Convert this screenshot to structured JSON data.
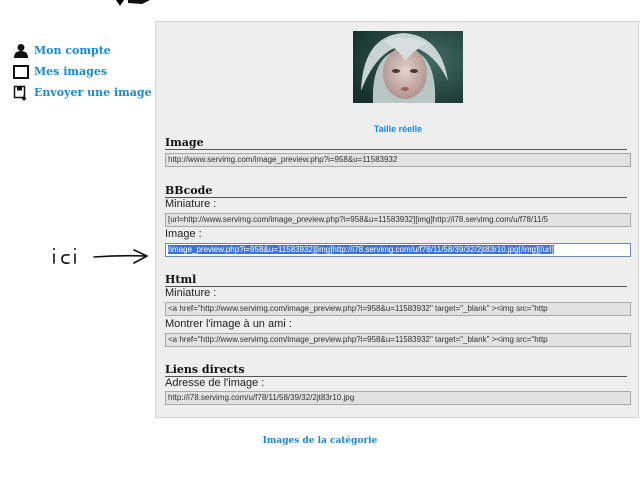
{
  "sidebar": {
    "items": [
      {
        "label": "Mon compte",
        "icon": "user-icon"
      },
      {
        "label": "Mes images",
        "icon": "image-frame-icon"
      },
      {
        "label": "Envoyer une image",
        "icon": "upload-icon"
      }
    ]
  },
  "panel": {
    "full_size_link": "Taille réelle",
    "sections": {
      "image": {
        "title": "Image",
        "value": "http://www.servimg.com/image_preview.php?i=958&u=11583932"
      },
      "bbcode": {
        "title": "BBcode",
        "miniature_label": "Miniature :",
        "miniature_value": "[url=http://www.servimg.com/image_preview.php?i=958&u=11583932][img]http://i78.servimg.com/u/f78/11/5",
        "image_label": "Image :",
        "image_value": "/image_preview.php?i=958&u=11583932][img]http://i78.servimg.com/u/f78/11/58/39/32/2jt83r10.jpg[/img][/url]"
      },
      "html": {
        "title": "Html",
        "miniature_label": "Miniature :",
        "miniature_value": "<a href=\"http://www.servimg.com/image_preview.php?i=958&u=11583932\"  target=\"_blank\" ><img src=\"http",
        "friend_label": "Montrer l'image à un ami :",
        "friend_value": "<a href=\"http://www.servimg.com/image_preview.php?i=958&u=11583932\" target=\"_blank\" ><img src=\"http"
      },
      "direct": {
        "title": "Liens directs",
        "address_label": "Adresse de l'image :",
        "address_value": "http://i78.servimg.com/u/f78/11/58/39/32/2jt83r10.jpg"
      }
    }
  },
  "annotation": {
    "text": "ici"
  },
  "footer": {
    "category_link": "Images de la catégorie"
  },
  "colors": {
    "link": "#1a88d8",
    "panel_bg": "#eeeeee",
    "selection": "#3875d7"
  }
}
